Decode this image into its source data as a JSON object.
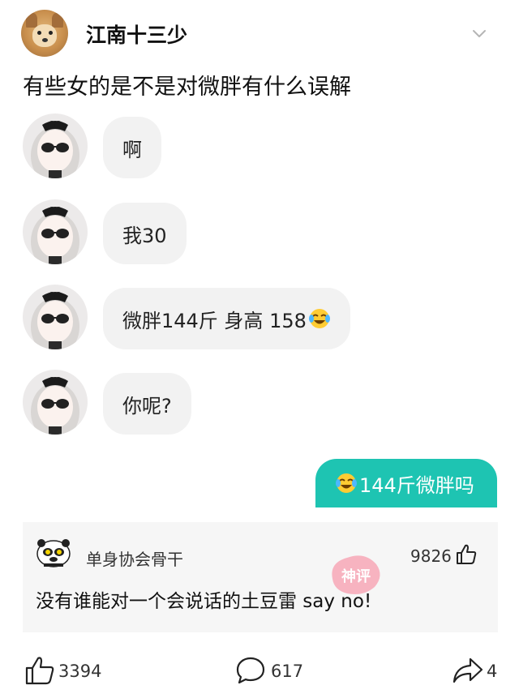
{
  "header": {
    "author_name": "江南十三少",
    "avatar_icon": "dog-avatar-icon",
    "menu_icon": "chevron-down-icon"
  },
  "post": {
    "title": "有些女的是不是对微胖有什么误解"
  },
  "chat": {
    "left_messages": [
      {
        "text": "啊"
      },
      {
        "text": "我30"
      },
      {
        "text": "微胖144斤 身高 158",
        "emoji": "crying-laughing-emoji"
      },
      {
        "text": "你呢?"
      }
    ],
    "right_message": {
      "emoji": "crying-laughing-emoji",
      "text": "144斤微胖吗"
    }
  },
  "comment": {
    "user_name": "单身协会骨干",
    "likes": "9826",
    "text": "没有谁能对一个会说话的土豆雷 say no!",
    "watermark": "神评",
    "avatar_icon": "panda-meme-avatar-icon"
  },
  "footer": {
    "likes": "3394",
    "comments": "617",
    "shares": "4"
  },
  "colors": {
    "accent": "#1ec4b2",
    "bubble": "#f2f2f2",
    "card": "#f6f6f6",
    "stamp": "#f7a3b3"
  }
}
